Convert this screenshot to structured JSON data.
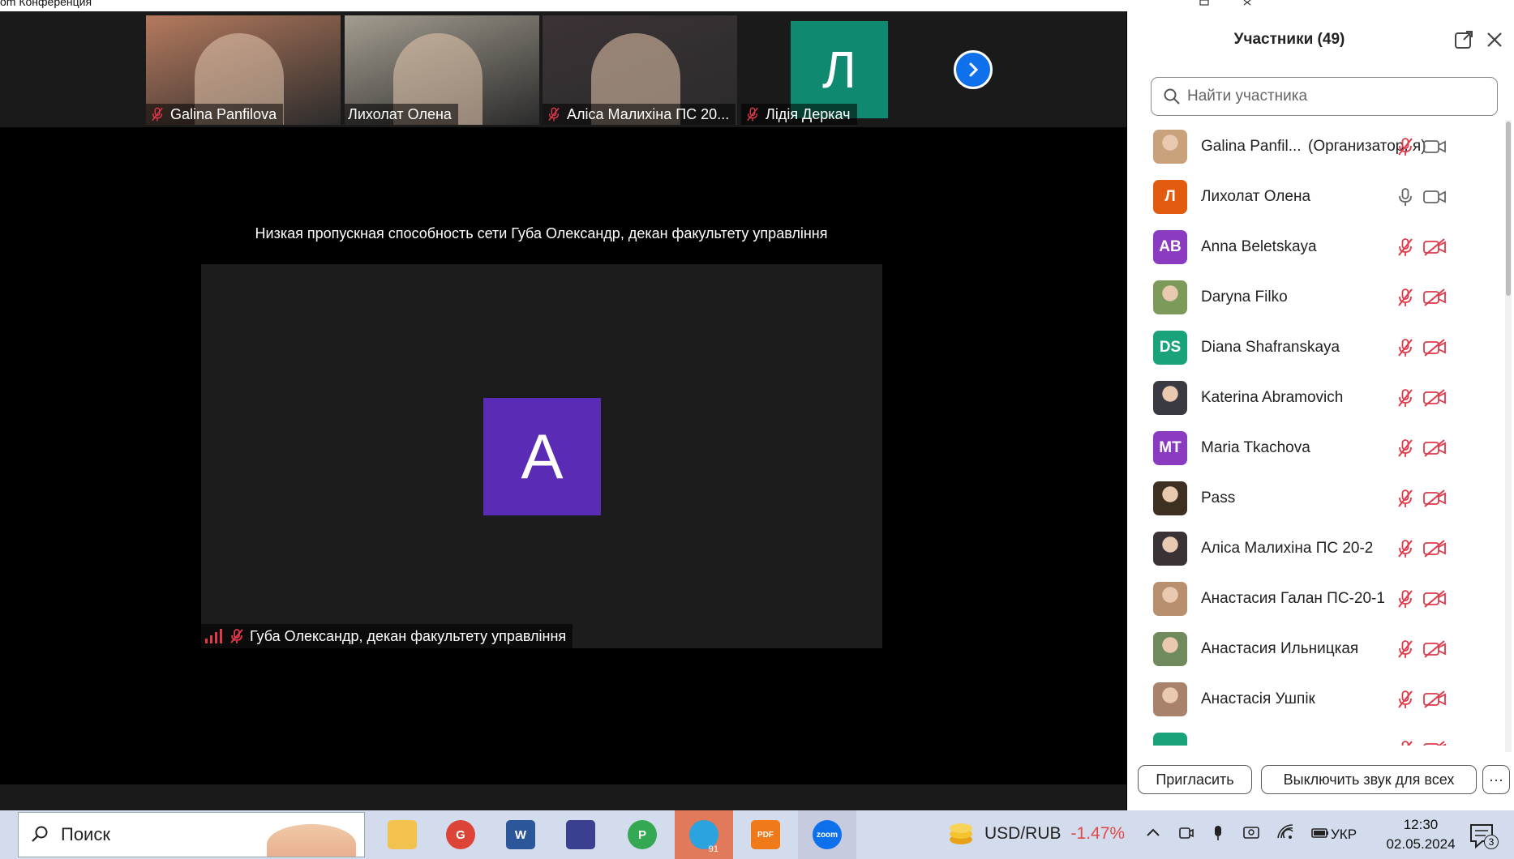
{
  "window": {
    "title": "om Конференция"
  },
  "thumbnails": [
    {
      "name": "Galina Panfilova",
      "muted": true,
      "type": "video",
      "bg": "#b57a5e"
    },
    {
      "name": "Лихолат Олена",
      "muted": false,
      "type": "video",
      "bg": "#a39c8f"
    },
    {
      "name": "Аліса Малихіна ПС 20...",
      "muted": true,
      "type": "video",
      "bg": "#3b3235"
    },
    {
      "name": "Лідія Деркач",
      "muted": true,
      "type": "avatar",
      "initial": "Л",
      "bg": "#0f8a70"
    }
  ],
  "main": {
    "network_warning": "Низкая пропускная способность сети Губа Олександр, декан факультету управління",
    "avatar_initial": "A",
    "speaker_name": "Губа Олександр, декан факультету управління"
  },
  "panel": {
    "title": "Участники (49)",
    "search_placeholder": "Найти участника",
    "participants": [
      {
        "name": "Galina Panfil...",
        "role": "(Организатор, я)",
        "avatar": "photo",
        "color": "#c9a27c",
        "mic": "muted",
        "cam": "on"
      },
      {
        "name": "Лихолат Олена",
        "avatar": "Л",
        "color": "#e35b0e",
        "mic": "on",
        "cam": "on"
      },
      {
        "name": "Anna Beletskaya",
        "avatar": "AB",
        "color": "#8a3bbf",
        "mic": "muted",
        "cam": "off"
      },
      {
        "name": "Daryna Filko",
        "avatar": "photo",
        "color": "#7c9a5a",
        "mic": "muted",
        "cam": "off"
      },
      {
        "name": "Diana Shafranskaya",
        "avatar": "DS",
        "color": "#1aa37a",
        "mic": "muted",
        "cam": "off"
      },
      {
        "name": "Katerina Abramovich",
        "avatar": "photo",
        "color": "#3a3a42",
        "mic": "muted",
        "cam": "off"
      },
      {
        "name": "Maria Tkachova",
        "avatar": "MT",
        "color": "#8a3bbf",
        "mic": "muted",
        "cam": "off"
      },
      {
        "name": "Pass",
        "avatar": "photo",
        "color": "#3d3020",
        "mic": "muted",
        "cam": "off"
      },
      {
        "name": "Аліса Малихіна ПС 20-2",
        "avatar": "photo",
        "color": "#3b3235",
        "mic": "muted",
        "cam": "off"
      },
      {
        "name": "Анастасия Галан ПС-20-1",
        "avatar": "photo",
        "color": "#b9906e",
        "mic": "muted",
        "cam": "off"
      },
      {
        "name": "Анастасия Ильницкая",
        "avatar": "photo",
        "color": "#6f8a5c",
        "mic": "muted",
        "cam": "off"
      },
      {
        "name": "Анастасія Ушпік",
        "avatar": "photo",
        "color": "#a8826b",
        "mic": "muted",
        "cam": "off"
      },
      {
        "name": "",
        "avatar": "",
        "color": "#1aa37a",
        "mic": "muted",
        "cam": "off"
      }
    ],
    "invite_label": "Пригласить",
    "mute_all_label": "Выключить звук для всех",
    "more_label": "···"
  },
  "taskbar": {
    "search_text": "Поиск",
    "apps": [
      {
        "name": "file-explorer",
        "color": "#f2c14e"
      },
      {
        "name": "chrome-g",
        "color": "#db4437",
        "letter": "G"
      },
      {
        "name": "word",
        "color": "#2b579a",
        "letter": "W"
      },
      {
        "name": "save-app",
        "color": "#3a3f8f"
      },
      {
        "name": "chrome-p",
        "color": "#34a853",
        "letter": "P"
      },
      {
        "name": "telegram",
        "color": "#2aa3de",
        "badge": "91"
      },
      {
        "name": "pdf-app",
        "color": "#f07a1a",
        "letter": "PDF"
      },
      {
        "name": "zoom",
        "color": "#0e71eb",
        "letter": "zoom"
      }
    ],
    "stock_name": "USD/RUB",
    "stock_change": "-1.47%",
    "language": "УКР",
    "time": "12:30",
    "date": "02.05.2024",
    "notification_count": "3"
  }
}
